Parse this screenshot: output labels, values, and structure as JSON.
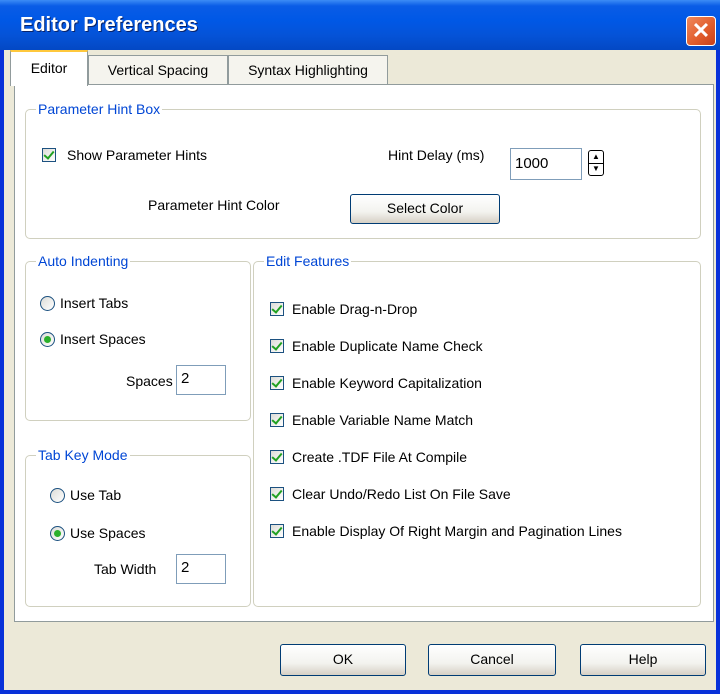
{
  "window": {
    "title": "Editor Preferences",
    "close_glyph": "✕"
  },
  "tabs": [
    {
      "label": "Editor"
    },
    {
      "label": "Vertical Spacing"
    },
    {
      "label": "Syntax Highlighting"
    }
  ],
  "param_hint": {
    "group_label": "Parameter Hint Box",
    "show_hints_label": "Show Parameter Hints",
    "show_hints_checked": true,
    "delay_label": "Hint Delay (ms)",
    "delay_value": "1000",
    "color_label": "Parameter Hint Color",
    "select_color_button": "Select Color"
  },
  "auto_indent": {
    "group_label": "Auto Indenting",
    "options": [
      "Insert Tabs",
      "Insert Spaces"
    ],
    "selected": "Insert Spaces",
    "spaces_label": "Spaces",
    "spaces_value": "2"
  },
  "tab_key_mode": {
    "group_label": "Tab Key  Mode",
    "options": [
      "Use Tab",
      "Use Spaces"
    ],
    "selected": "Use Spaces",
    "width_label": "Tab Width",
    "width_value": "2"
  },
  "edit_features": {
    "group_label": "Edit Features",
    "items": [
      {
        "label": "Enable Drag-n-Drop",
        "checked": true
      },
      {
        "label": "Enable Duplicate Name Check",
        "checked": true
      },
      {
        "label": "Enable Keyword Capitalization",
        "checked": true
      },
      {
        "label": "Enable Variable Name Match",
        "checked": true
      },
      {
        "label": "Create .TDF File At Compile",
        "checked": true
      },
      {
        "label": "Clear Undo/Redo List On File Save",
        "checked": true
      },
      {
        "label": "Enable Display Of Right Margin and Pagination Lines",
        "checked": true
      }
    ]
  },
  "buttons": {
    "ok": "OK",
    "cancel": "Cancel",
    "help": "Help"
  },
  "colors": {
    "title_bar": "#0058e6",
    "dialog_bg": "#ece9d8",
    "group_label": "#0046d5",
    "check_mark": "#21a121"
  }
}
